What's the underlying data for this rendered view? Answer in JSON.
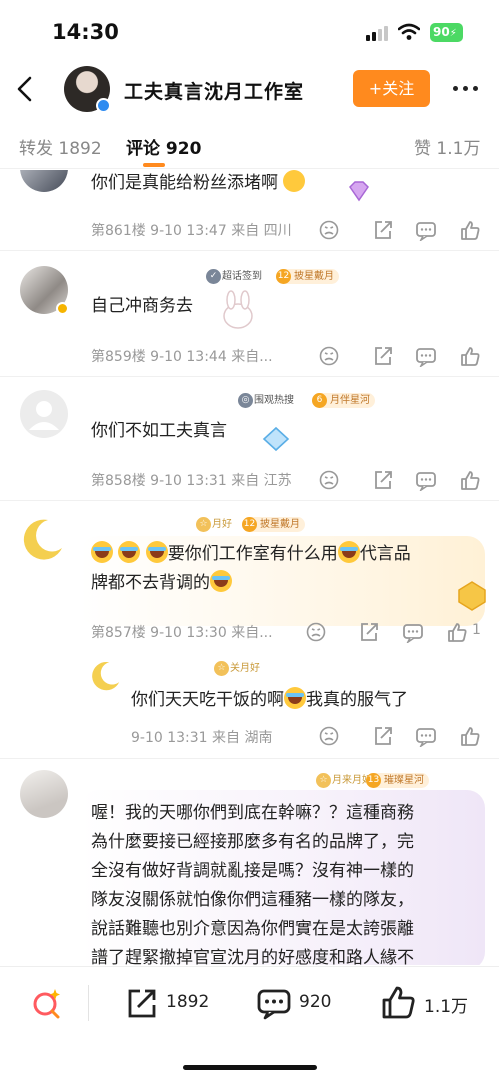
{
  "status_bar": {
    "time": "14:30",
    "battery": "90"
  },
  "header": {
    "title": "工夫真言沈月工作室",
    "follow_label": "+关注"
  },
  "tabs": {
    "repost": "转发 1892",
    "comments": "评论 920",
    "likes": "赞 1.1万"
  },
  "comments": [
    {
      "text": "你们是真能给粉丝添堵啊",
      "meta": "第861楼 9-10 13:47 来自 四川"
    },
    {
      "badge1": "超话签到",
      "badge2_level": "12",
      "badge2": "披星戴月",
      "text": "自己冲商务去",
      "meta": "第859楼 9-10 13:44 来自..."
    },
    {
      "badge1": "围观热搜",
      "badge2_level": "6",
      "badge2": "月伴星河",
      "text": "你们不如工夫真言",
      "meta": "第858楼 9-10 13:31 来自 江苏"
    },
    {
      "badge1": "月好",
      "badge2_level": "12",
      "badge2": "披星戴月",
      "text_line1": "要你们工作室有什么用",
      "text_line1_tail": "代言品",
      "text_line2": "牌都不去背调的",
      "meta": "第857楼 9-10 13:30 来自...",
      "like_count": "1"
    },
    {
      "badge1": "关月好",
      "text": "你们天天吃干饭的啊",
      "text_tail": "我真的服气了",
      "meta": "9-10 13:31 来自 湖南"
    },
    {
      "badge1": "月来月好",
      "badge2_level": "13",
      "badge2": "璀璨星河",
      "lines": [
        "喔！我的天哪你們到底在幹嘛？？這種商務",
        "為什麼要接已經接那麼多有名的品牌了，完",
        "全沒有做好背調就亂接是嗎？沒有神一樣的",
        "隊友沒關係就怕像你們這種豬一樣的隊友，",
        "說話難聽也別介意因為你們實在是太誇張離",
        "譜了趕緊撤掉官宣沈月的好感度和路人緣不"
      ]
    }
  ],
  "bottom_bar": {
    "repost_count": "1892",
    "comment_count": "920",
    "like_count": "1.1万"
  },
  "colors": {
    "accent": "#ff8a1e",
    "muted": "#999999"
  }
}
